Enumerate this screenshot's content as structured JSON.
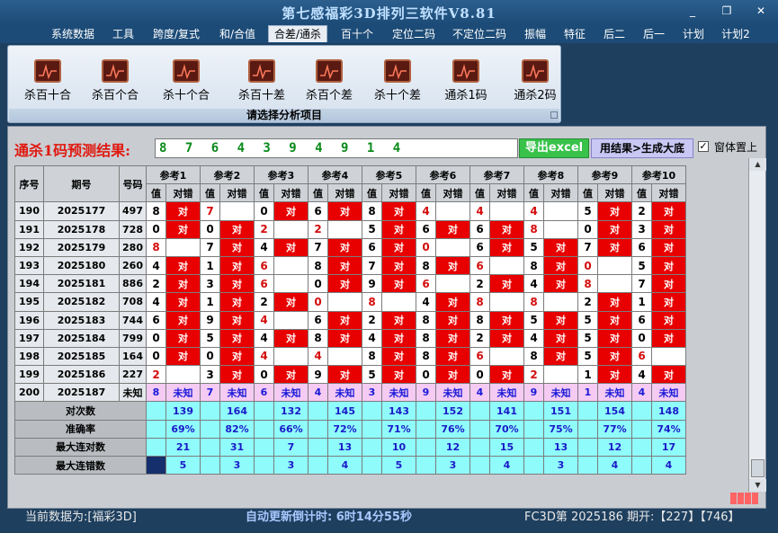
{
  "app": {
    "title": "第七感福彩3D排列三软件V8.81"
  },
  "window_controls": {
    "minimize": "_",
    "restore": "❐",
    "close": "✕"
  },
  "menu": [
    "系统数据",
    "工具",
    "跨度/复式",
    "和/合值",
    "合差/通杀",
    "百十个",
    "定位二码",
    "不定位二码",
    "振幅",
    "特征",
    "后二",
    "后一",
    "计划",
    "计划2"
  ],
  "ribbon": {
    "buttons": [
      "杀百十合",
      "杀百个合",
      "杀十个合",
      "杀百十差",
      "杀百个差",
      "杀十个差",
      "通杀1码",
      "通杀2码"
    ],
    "footer": "请选择分析项目"
  },
  "prediction": {
    "label": "通杀1码预测结果:",
    "value": "8 7 6 4 3 9 4 9 1 4"
  },
  "buttons": {
    "excel": "导出excel",
    "generate": "用结果>生成大底"
  },
  "checkbox": {
    "label": "窗体置上",
    "checked": "✓"
  },
  "table": {
    "headers": {
      "seq": "序号",
      "issue": "期号",
      "num": "号码",
      "refs": [
        "参考1",
        "参考2",
        "参考3",
        "参考4",
        "参考5",
        "参考6",
        "参考7",
        "参考8",
        "参考9",
        "参考10"
      ],
      "val": "值",
      "res": "对错"
    },
    "rows": [
      {
        "seq": "190",
        "issue": "2025177",
        "num": "497",
        "refs": [
          [
            "8",
            "对"
          ],
          [
            "7",
            ""
          ],
          [
            "0",
            "对"
          ],
          [
            "6",
            "对"
          ],
          [
            "8",
            "对"
          ],
          [
            "4",
            ""
          ],
          [
            "4",
            ""
          ],
          [
            "4",
            ""
          ],
          [
            "5",
            "对"
          ],
          [
            "2",
            "对"
          ]
        ]
      },
      {
        "seq": "191",
        "issue": "2025178",
        "num": "728",
        "refs": [
          [
            "0",
            "对"
          ],
          [
            "0",
            "对"
          ],
          [
            "2",
            ""
          ],
          [
            "2",
            ""
          ],
          [
            "5",
            "对"
          ],
          [
            "6",
            "对"
          ],
          [
            "6",
            "对"
          ],
          [
            "8",
            ""
          ],
          [
            "0",
            "对"
          ],
          [
            "3",
            "对"
          ]
        ]
      },
      {
        "seq": "192",
        "issue": "2025179",
        "num": "280",
        "refs": [
          [
            "8",
            ""
          ],
          [
            "7",
            "对"
          ],
          [
            "4",
            "对"
          ],
          [
            "7",
            "对"
          ],
          [
            "6",
            "对"
          ],
          [
            "0",
            ""
          ],
          [
            "6",
            "对"
          ],
          [
            "5",
            "对"
          ],
          [
            "7",
            "对"
          ],
          [
            "6",
            "对"
          ]
        ]
      },
      {
        "seq": "193",
        "issue": "2025180",
        "num": "260",
        "refs": [
          [
            "4",
            "对"
          ],
          [
            "1",
            "对"
          ],
          [
            "6",
            ""
          ],
          [
            "8",
            "对"
          ],
          [
            "7",
            "对"
          ],
          [
            "8",
            "对"
          ],
          [
            "6",
            ""
          ],
          [
            "8",
            "对"
          ],
          [
            "0",
            ""
          ],
          [
            "5",
            "对"
          ]
        ]
      },
      {
        "seq": "194",
        "issue": "2025181",
        "num": "886",
        "refs": [
          [
            "2",
            "对"
          ],
          [
            "3",
            "对"
          ],
          [
            "6",
            ""
          ],
          [
            "0",
            "对"
          ],
          [
            "9",
            "对"
          ],
          [
            "6",
            ""
          ],
          [
            "2",
            "对"
          ],
          [
            "4",
            "对"
          ],
          [
            "8",
            ""
          ],
          [
            "7",
            "对"
          ]
        ]
      },
      {
        "seq": "195",
        "issue": "2025182",
        "num": "708",
        "refs": [
          [
            "4",
            "对"
          ],
          [
            "1",
            "对"
          ],
          [
            "2",
            "对"
          ],
          [
            "0",
            ""
          ],
          [
            "8",
            ""
          ],
          [
            "4",
            "对"
          ],
          [
            "8",
            ""
          ],
          [
            "8",
            ""
          ],
          [
            "2",
            "对"
          ],
          [
            "1",
            "对"
          ]
        ]
      },
      {
        "seq": "196",
        "issue": "2025183",
        "num": "744",
        "refs": [
          [
            "6",
            "对"
          ],
          [
            "9",
            "对"
          ],
          [
            "4",
            ""
          ],
          [
            "6",
            "对"
          ],
          [
            "2",
            "对"
          ],
          [
            "8",
            "对"
          ],
          [
            "8",
            "对"
          ],
          [
            "5",
            "对"
          ],
          [
            "5",
            "对"
          ],
          [
            "6",
            "对"
          ]
        ]
      },
      {
        "seq": "197",
        "issue": "2025184",
        "num": "799",
        "refs": [
          [
            "0",
            "对"
          ],
          [
            "5",
            "对"
          ],
          [
            "4",
            "对"
          ],
          [
            "8",
            "对"
          ],
          [
            "4",
            "对"
          ],
          [
            "8",
            "对"
          ],
          [
            "2",
            "对"
          ],
          [
            "4",
            "对"
          ],
          [
            "5",
            "对"
          ],
          [
            "0",
            "对"
          ]
        ]
      },
      {
        "seq": "198",
        "issue": "2025185",
        "num": "164",
        "refs": [
          [
            "0",
            "对"
          ],
          [
            "0",
            "对"
          ],
          [
            "4",
            ""
          ],
          [
            "4",
            ""
          ],
          [
            "8",
            "对"
          ],
          [
            "8",
            "对"
          ],
          [
            "6",
            ""
          ],
          [
            "8",
            "对"
          ],
          [
            "5",
            "对"
          ],
          [
            "6",
            ""
          ]
        ]
      },
      {
        "seq": "199",
        "issue": "2025186",
        "num": "227",
        "refs": [
          [
            "2",
            ""
          ],
          [
            "3",
            "对"
          ],
          [
            "0",
            "对"
          ],
          [
            "9",
            "对"
          ],
          [
            "5",
            "对"
          ],
          [
            "0",
            "对"
          ],
          [
            "0",
            "对"
          ],
          [
            "2",
            ""
          ],
          [
            "1",
            "对"
          ],
          [
            "4",
            "对"
          ]
        ]
      }
    ],
    "pending": {
      "seq": "200",
      "issue": "2025187",
      "num": "未知",
      "refs": [
        "8",
        "7",
        "6",
        "4",
        "3",
        "9",
        "4",
        "9",
        "1",
        "4"
      ],
      "res": "未知"
    },
    "stats": [
      {
        "label": "对次数",
        "values": [
          "139",
          "164",
          "132",
          "145",
          "143",
          "152",
          "141",
          "151",
          "154",
          "148"
        ]
      },
      {
        "label": "准确率",
        "values": [
          "69%",
          "82%",
          "66%",
          "72%",
          "71%",
          "76%",
          "70%",
          "75%",
          "77%",
          "74%"
        ]
      },
      {
        "label": "最大连对数",
        "values": [
          "21",
          "31",
          "7",
          "13",
          "10",
          "12",
          "15",
          "13",
          "12",
          "17"
        ]
      },
      {
        "label": "最大连错数",
        "values": [
          "5",
          "3",
          "3",
          "4",
          "5",
          "3",
          "4",
          "3",
          "4",
          "4"
        ]
      }
    ]
  },
  "status": {
    "current_data": "当前数据为:[福彩3D]",
    "countdown": "自动更新倒计时:  6时14分55秒",
    "draw": "FC3D第 2025186 期开:【227】【746】"
  },
  "colors": {
    "hit": "#e80000",
    "miss_text": "#d40c0c",
    "pending": "#f5caf3",
    "stats": "#8ffbfb"
  }
}
